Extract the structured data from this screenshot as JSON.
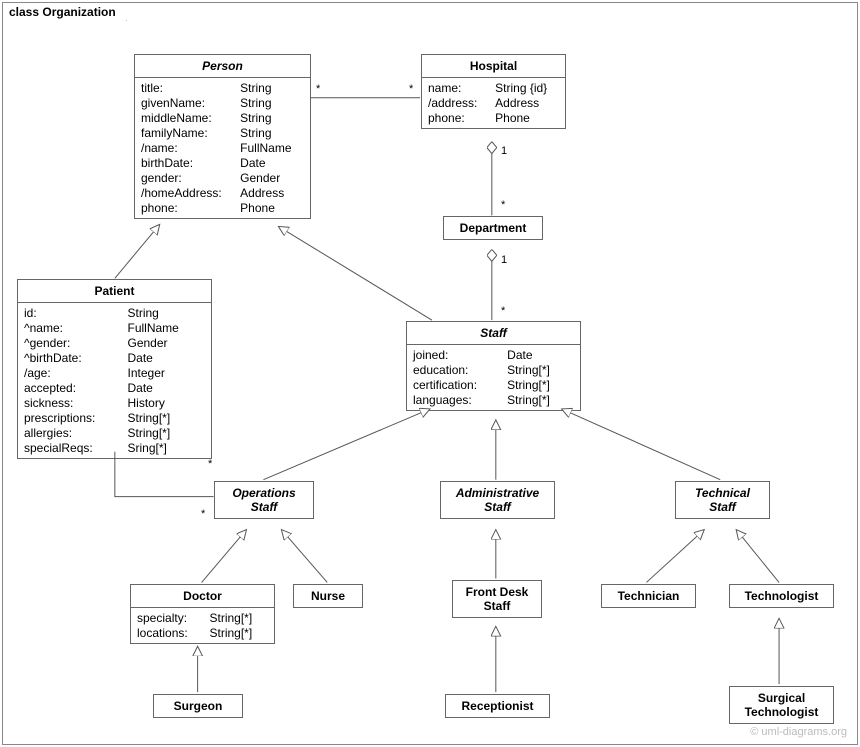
{
  "frame": {
    "title": "class Organization"
  },
  "watermark": "© uml-diagrams.org",
  "classes": {
    "person": {
      "name": "Person",
      "attrs": [
        [
          "title:",
          "String"
        ],
        [
          "givenName:",
          "String"
        ],
        [
          "middleName:",
          "String"
        ],
        [
          "familyName:",
          "String"
        ],
        [
          "/name:",
          "FullName"
        ],
        [
          "birthDate:",
          "Date"
        ],
        [
          "gender:",
          "Gender"
        ],
        [
          "/homeAddress:",
          "Address"
        ],
        [
          "phone:",
          "Phone"
        ]
      ]
    },
    "hospital": {
      "name": "Hospital",
      "attrs": [
        [
          "name:",
          "String {id}"
        ],
        [
          "/address:",
          "Address"
        ],
        [
          "phone:",
          "Phone"
        ]
      ]
    },
    "department": {
      "name": "Department"
    },
    "patient": {
      "name": "Patient",
      "attrs": [
        [
          "id:",
          "String"
        ],
        [
          "^name:",
          "FullName"
        ],
        [
          "^gender:",
          "Gender"
        ],
        [
          "^birthDate:",
          "Date"
        ],
        [
          "/age:",
          "Integer"
        ],
        [
          "accepted:",
          "Date"
        ],
        [
          "sickness:",
          "History"
        ],
        [
          "prescriptions:",
          "String[*]"
        ],
        [
          "allergies:",
          "String[*]"
        ],
        [
          "specialReqs:",
          "Sring[*]"
        ]
      ]
    },
    "staff": {
      "name": "Staff",
      "attrs": [
        [
          "joined:",
          "Date"
        ],
        [
          "education:",
          "String[*]"
        ],
        [
          "certification:",
          "String[*]"
        ],
        [
          "languages:",
          "String[*]"
        ]
      ]
    },
    "opsStaff": {
      "name": "Operations",
      "name2": "Staff"
    },
    "adminStaff": {
      "name": "Administrative",
      "name2": "Staff"
    },
    "techStaff": {
      "name": "Technical",
      "name2": "Staff"
    },
    "doctor": {
      "name": "Doctor",
      "attrs": [
        [
          "specialty:",
          "String[*]"
        ],
        [
          "locations:",
          "String[*]"
        ]
      ]
    },
    "nurse": {
      "name": "Nurse"
    },
    "frontDesk": {
      "name": "Front Desk",
      "name2": "Staff"
    },
    "technician": {
      "name": "Technician"
    },
    "technologist": {
      "name": "Technologist"
    },
    "surgeon": {
      "name": "Surgeon"
    },
    "receptionist": {
      "name": "Receptionist"
    },
    "surgTech": {
      "name": "Surgical",
      "name2": "Technologist"
    }
  },
  "mult": {
    "personHosp_pL": "*",
    "personHosp_hL": "*",
    "hospDept_h": "1",
    "hospDept_d": "*",
    "deptStaff_d": "1",
    "deptStaff_s": "*",
    "patOps_p": "*",
    "patOps_o": "*"
  }
}
